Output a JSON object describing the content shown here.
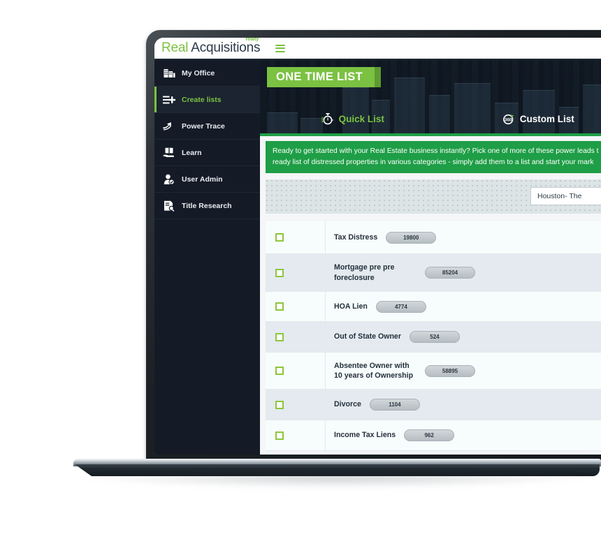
{
  "brand": {
    "word_one": "Real",
    "word_two": "Acquisitions",
    "superscript": "realty",
    "menu_icon": "hamburger-icon"
  },
  "sidebar": {
    "items": [
      {
        "label": "My Office",
        "icon": "office-building-icon",
        "active": false
      },
      {
        "label": "Create lists",
        "icon": "list-plus-icon",
        "active": true
      },
      {
        "label": "Power Trace",
        "icon": "arrow-trace-icon",
        "active": false
      },
      {
        "label": "Learn",
        "icon": "book-hand-icon",
        "active": false
      },
      {
        "label": "User Admin",
        "icon": "user-check-icon",
        "active": false
      },
      {
        "label": "Title Research",
        "icon": "document-search-icon",
        "active": false
      }
    ]
  },
  "hero": {
    "badge": "ONE TIME LIST",
    "tabs": [
      {
        "label": "Quick List",
        "icon": "stopwatch-icon",
        "active": true
      },
      {
        "label": "Custom List",
        "icon": "360-refresh-icon",
        "active": false
      }
    ]
  },
  "info_banner": {
    "line_one": "Ready to get started with your Real Estate business instantly? Pick one of more of these power leads t",
    "line_two": "ready list of distressed properties in various categories - simply add them to a list and start your mark"
  },
  "filters": {
    "location_value": "Houston- The"
  },
  "table": {
    "rows": [
      {
        "label": "Tax Distress",
        "count": "19800",
        "checked": false
      },
      {
        "label": "Mortgage pre pre foreclosure",
        "count": "85204",
        "checked": false
      },
      {
        "label": "HOA Lien",
        "count": "4774",
        "checked": false
      },
      {
        "label": "Out of State Owner",
        "count": "524",
        "checked": false
      },
      {
        "label": "Absentee Owner with 10 years of Ownership",
        "count": "58895",
        "checked": false
      },
      {
        "label": "Divorce",
        "count": "1104",
        "checked": false
      },
      {
        "label": "Income Tax Liens",
        "count": "962",
        "checked": false
      }
    ]
  },
  "colors": {
    "brand_green": "#7bc142",
    "banner_green": "#1e9e46",
    "sidebar_dark": "#141b26",
    "checkbox_green": "#8cc63f"
  }
}
